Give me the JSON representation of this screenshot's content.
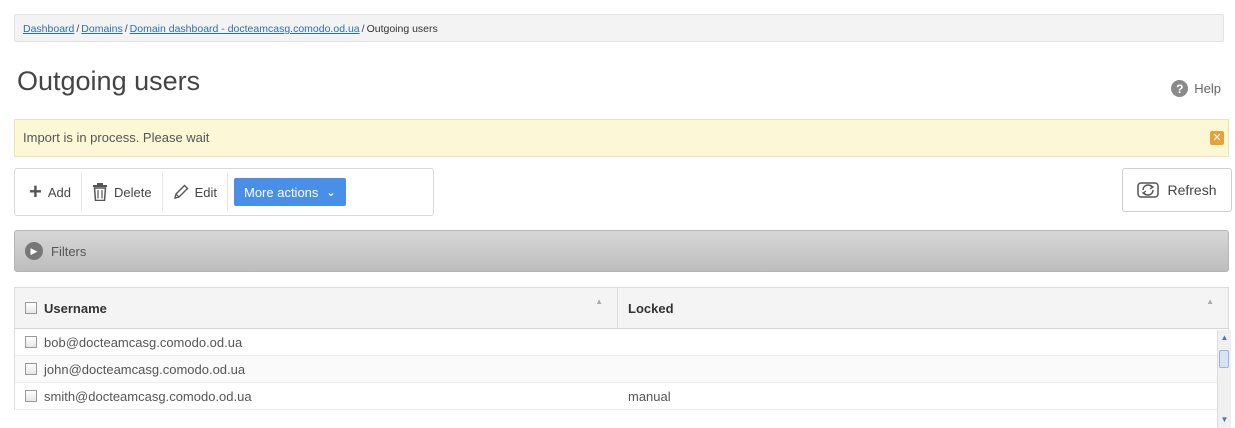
{
  "breadcrumb": {
    "items": [
      "Dashboard",
      "Domains",
      "Domain dashboard - docteamcasg.comodo.od.ua"
    ],
    "current": "Outgoing users",
    "separator": "/"
  },
  "page": {
    "title": "Outgoing users",
    "help_label": "Help"
  },
  "notice": {
    "text": "Import is in process. Please wait"
  },
  "toolbar": {
    "add_label": "Add",
    "delete_label": "Delete",
    "edit_label": "Edit",
    "more_actions_label": "More actions",
    "refresh_label": "Refresh"
  },
  "filters": {
    "label": "Filters"
  },
  "table": {
    "columns": [
      "Username",
      "Locked"
    ],
    "rows": [
      {
        "username": "bob@docteamcasg.comodo.od.ua",
        "locked": ""
      },
      {
        "username": "john@docteamcasg.comodo.od.ua",
        "locked": ""
      },
      {
        "username": "smith@docteamcasg.comodo.od.ua",
        "locked": "manual"
      }
    ]
  },
  "colors": {
    "accent": "#4a8fe7",
    "link": "#2a6fb8",
    "notice_bg": "#fcf8d6",
    "notice_close": "#e8a038"
  }
}
